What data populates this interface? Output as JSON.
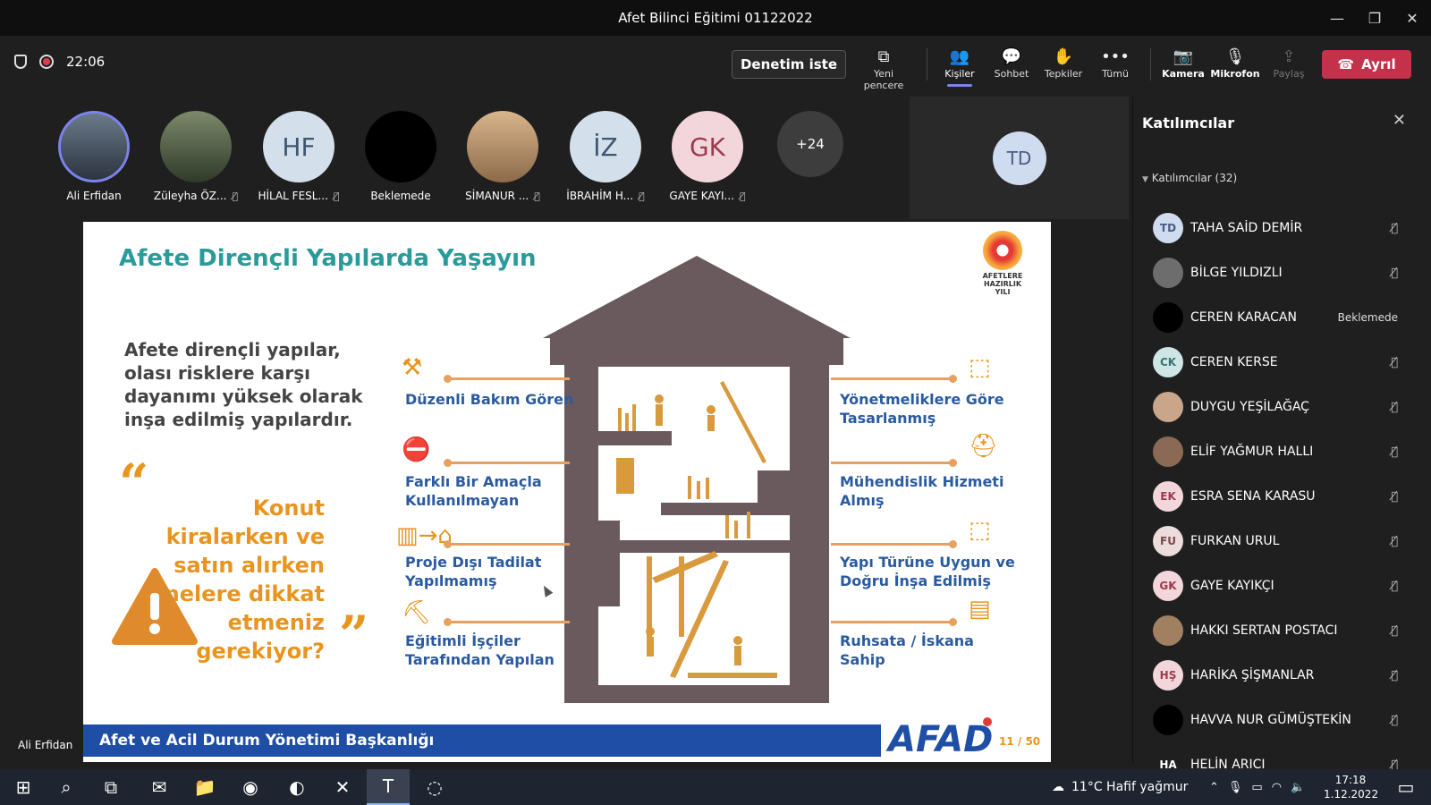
{
  "window": {
    "title": "Afet Bilinci Eğitimi 01122022"
  },
  "toolbar": {
    "timer": "22:06",
    "request_control": "Denetim iste",
    "items": [
      {
        "label": "Yeni pencere",
        "icon": "pop-out-icon"
      },
      {
        "label": "Kişiler",
        "icon": "people-icon"
      },
      {
        "label": "Sohbet",
        "icon": "chat-icon"
      },
      {
        "label": "Tepkiler",
        "icon": "reactions-icon"
      },
      {
        "label": "Tümü",
        "icon": "more-icon"
      },
      {
        "label": "Kamera",
        "icon": "camera-off-icon"
      },
      {
        "label": "Mikrofon",
        "icon": "mic-off-icon"
      },
      {
        "label": "Paylaş",
        "icon": "share-icon"
      }
    ],
    "leave": "Ayrıl"
  },
  "strip": {
    "tiles": [
      {
        "name": "Ali Erfidan",
        "initials": "",
        "type": "photo"
      },
      {
        "name": "Züleyha ÖZ...",
        "initials": "",
        "type": "photo"
      },
      {
        "name": "HİLAL FESL...",
        "initials": "HF",
        "type": "initials"
      },
      {
        "name": "Beklemede",
        "initials": "",
        "type": "black"
      },
      {
        "name": "SİMANUR ...",
        "initials": "",
        "type": "photo"
      },
      {
        "name": "İBRAHİM H...",
        "initials": "İZ",
        "type": "initials"
      },
      {
        "name": "GAYE KAYI...",
        "initials": "GK",
        "type": "initials"
      }
    ],
    "more": "+24",
    "td_tile": "TD"
  },
  "slide": {
    "title": "Afete Dirençli Yapılarda Yaşayın",
    "intro": "Afete dirençli yapılar, olası risklere karşı dayanımı yüksek olarak inşa edilmiş yapılardır.",
    "quote": "Konut kiralarken ve satın alırken nelere dikkat etmeniz gerekiyor?",
    "left_features": [
      "Düzenli Bakım Gören",
      "Farklı Bir Amaçla Kullanılmayan",
      "Proje Dışı Tadilat Yapılmamış",
      "Eğitimli İşçiler Tarafından Yapılan"
    ],
    "right_features": [
      "Yönetmeliklere Göre Tasarlanmış",
      "Mühendislik Hizmeti Almış",
      "Yapı Türüne Uygun ve Doğru İnşa Edilmiş",
      "Ruhsata / İskana Sahip"
    ],
    "badge": "AFETLERE HAZIRLIK YILI",
    "footer": "Afet ve Acil Durum Yönetimi Başkanlığı",
    "brand": "AFAD",
    "page": "11 / 50"
  },
  "speaker_label": "Ali Erfidan",
  "sidebar": {
    "title": "Katılımcılar",
    "group": "Katılımcılar (32)",
    "participants": [
      {
        "initials": "TD",
        "name": "TAHA SAİD DEMİR",
        "status": "",
        "color": "#cfdcef",
        "fg": "#4a5b84"
      },
      {
        "initials": "",
        "name": "BİLGE YILDIZLI",
        "status": "",
        "color": "#6d6d6d",
        "fg": "#fff"
      },
      {
        "initials": "",
        "name": "CEREN KARACAN",
        "status": "Beklemede",
        "color": "#000000",
        "fg": "#fff"
      },
      {
        "initials": "CK",
        "name": "CEREN KERSE",
        "status": "",
        "color": "#cfe6e6",
        "fg": "#3a7373"
      },
      {
        "initials": "",
        "name": "DUYGU YEŞİLAĞAÇ",
        "status": "",
        "color": "#c9a58a",
        "fg": "#fff"
      },
      {
        "initials": "",
        "name": "ELİF YAĞMUR HALLI",
        "status": "",
        "color": "#8a6a55",
        "fg": "#fff"
      },
      {
        "initials": "EK",
        "name": "ESRA SENA KARASU",
        "status": "",
        "color": "#f3d6dc",
        "fg": "#9c3a4e"
      },
      {
        "initials": "FU",
        "name": "FURKAN URUL",
        "status": "",
        "color": "#eddcdc",
        "fg": "#7a4a4a"
      },
      {
        "initials": "GK",
        "name": "GAYE KAYIKÇI",
        "status": "",
        "color": "#f3d6dc",
        "fg": "#9c3a4e"
      },
      {
        "initials": "",
        "name": "HAKKI SERTAN POSTACI",
        "status": "",
        "color": "#a08060",
        "fg": "#fff"
      },
      {
        "initials": "HŞ",
        "name": "HARİKA ŞİŞMANLAR",
        "status": "",
        "color": "#f3d6dc",
        "fg": "#9c3a4e"
      },
      {
        "initials": "",
        "name": "HAVVA NUR GÜMÜŞTEKİN",
        "status": "",
        "color": "#000000",
        "fg": "#fff"
      },
      {
        "initials": "HA",
        "name": "HELİN ARICI",
        "status": "",
        "color": "#1f1f1f",
        "fg": "#fff"
      }
    ]
  },
  "taskbar": {
    "weather": "11°C  Hafif yağmur",
    "time": "17:18",
    "date": "1.12.2022"
  }
}
